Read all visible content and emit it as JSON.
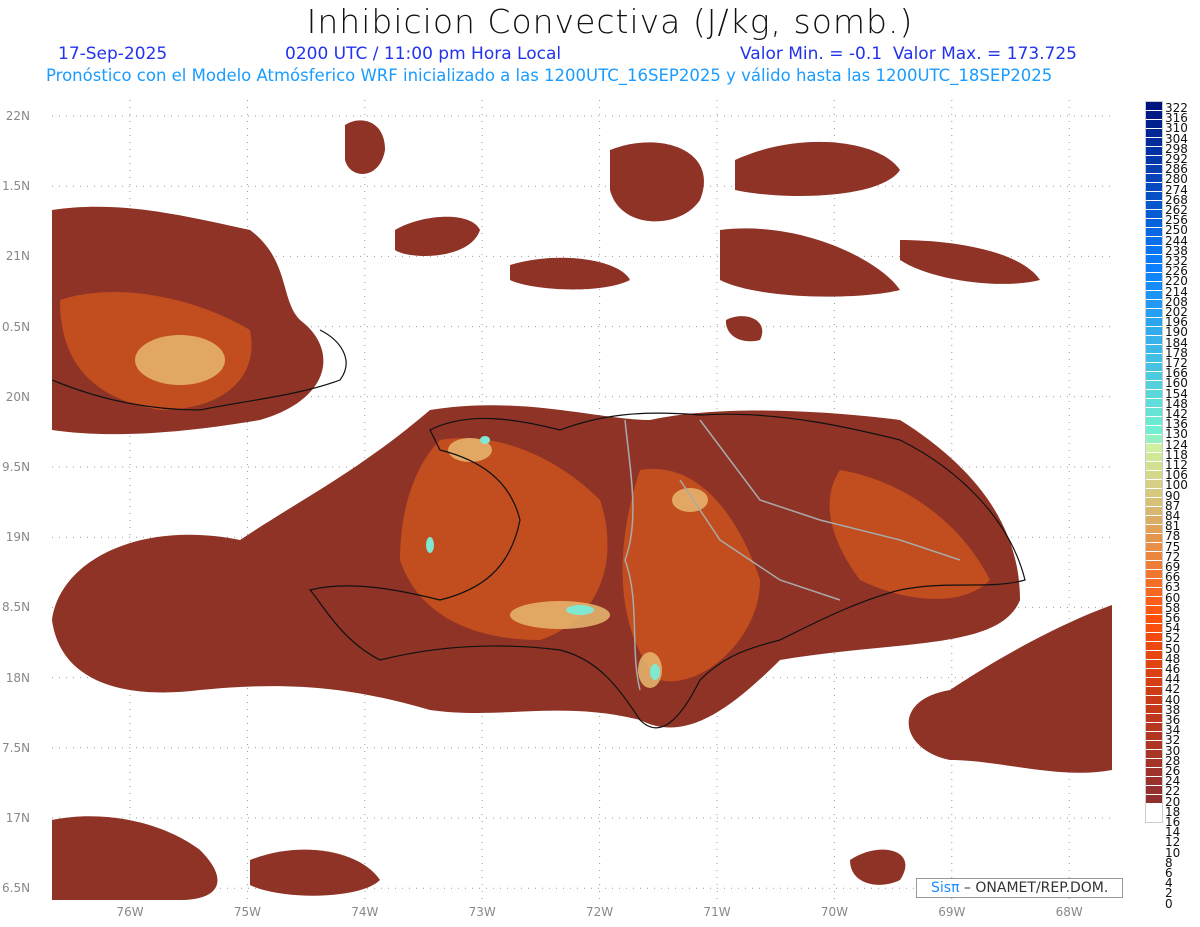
{
  "title": "Inhibicion Convectiva (J/kg, somb.)",
  "date": "17-Sep-2025",
  "time": "0200 UTC / 11:00 pm Hora Local",
  "min_max": "Valor Min. = -0.1  Valor Max. = 173.725",
  "subtitle": "Pronóstico con el Modelo Atmósferico WRF inicializado a las 1200UTC_16SEP2025 y válido hasta las  1200UTC_18SEP2025",
  "credit": {
    "brand": "Sisπ",
    "text": " – ONAMET/REP.DOM."
  },
  "lat_labels": [
    "22N",
    "1.5N",
    "21N",
    "0.5N",
    "20N",
    "9.5N",
    "19N",
    "8.5N",
    "18N",
    "7.5N",
    "17N",
    "6.5N"
  ],
  "lon_labels": [
    "76W",
    "75W",
    "74W",
    "73W",
    "72W",
    "71W",
    "70W",
    "69W",
    "68W"
  ],
  "colorbar_levels": [
    "322",
    "316",
    "310",
    "304",
    "298",
    "292",
    "286",
    "280",
    "274",
    "268",
    "262",
    "256",
    "250",
    "244",
    "238",
    "232",
    "226",
    "220",
    "214",
    "208",
    "202",
    "196",
    "190",
    "184",
    "178",
    "172",
    "166",
    "160",
    "154",
    "148",
    "142",
    "136",
    "130",
    "124",
    "118",
    "112",
    "106",
    "100",
    "90",
    "87",
    "84",
    "81",
    "78",
    "75",
    "72",
    "69",
    "66",
    "63",
    "60",
    "58",
    "56",
    "54",
    "52",
    "50",
    "48",
    "46",
    "44",
    "42",
    "40",
    "38",
    "36",
    "34",
    "32",
    "30",
    "28",
    "26",
    "24",
    "22",
    "20",
    "18",
    "16",
    "14",
    "12",
    "10",
    "8",
    "6",
    "4",
    "2",
    "0"
  ],
  "colors": {
    "low": "#8e2f26",
    "mid": "#c84a1c",
    "high": "#e8b060",
    "peak": "#7fe8d0"
  }
}
